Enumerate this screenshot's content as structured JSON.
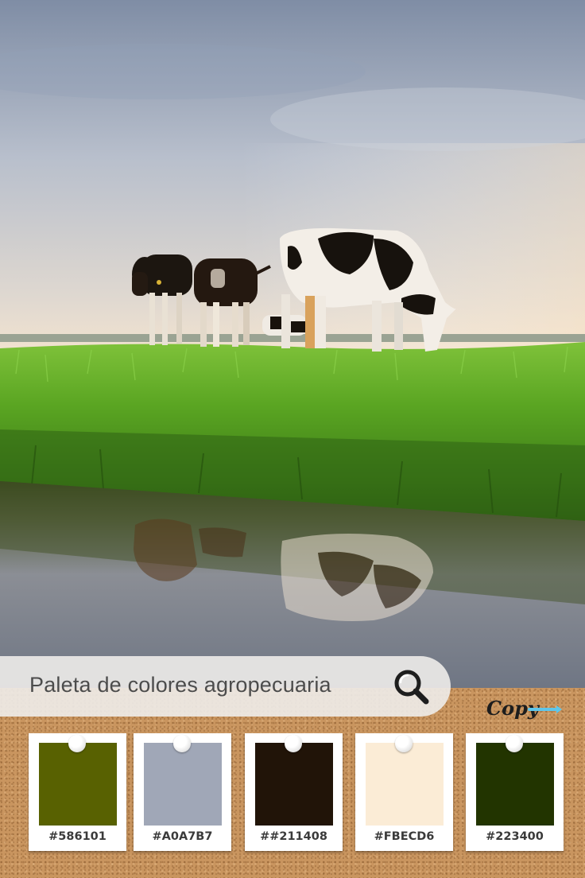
{
  "search": {
    "text": "Paleta de colores agropecuaria"
  },
  "logo": {
    "text": "Copy"
  },
  "palette": [
    {
      "hex_label": "#586101",
      "color": "#586101"
    },
    {
      "hex_label": "#A0A7B7",
      "color": "#A0A7B7"
    },
    {
      "hex_label": "##211408",
      "color": "#211408"
    },
    {
      "hex_label": "#FBECD6",
      "color": "#FBECD6"
    },
    {
      "hex_label": "#223400",
      "color": "#223400"
    }
  ]
}
